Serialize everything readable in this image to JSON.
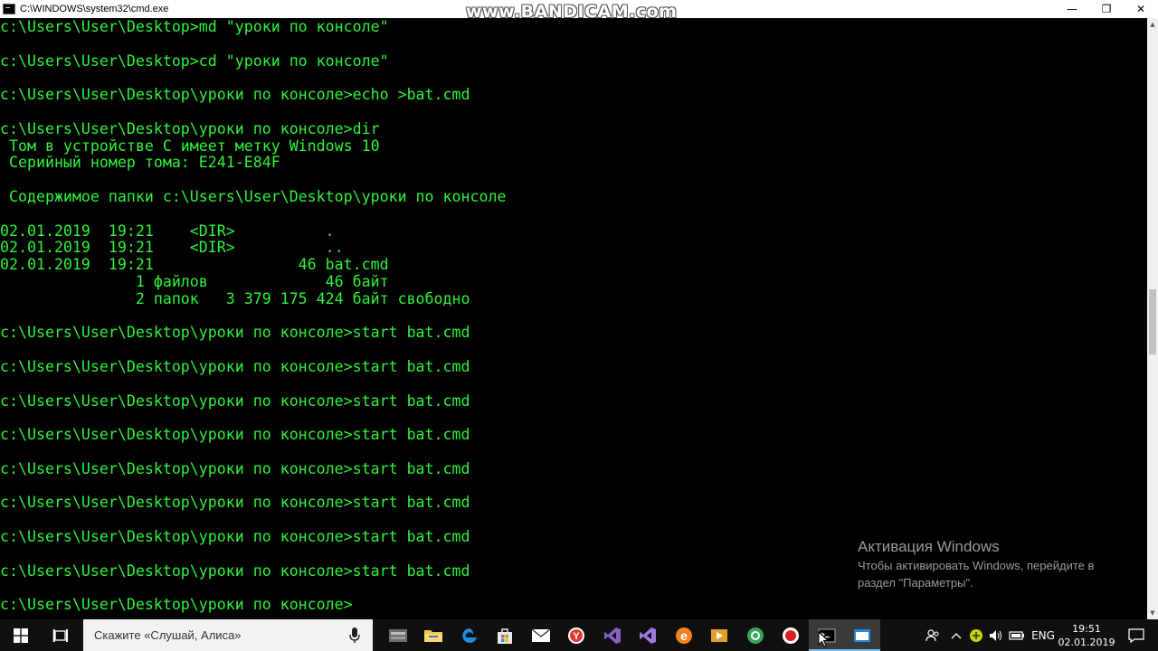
{
  "window": {
    "title": "C:\\WINDOWS\\system32\\cmd.exe",
    "watermark": "www.BANDICAM.com",
    "minimize_glyph": "—",
    "maximize_glyph": "❐",
    "close_glyph": "✕"
  },
  "console": {
    "text_color": "#2df33a",
    "lines": [
      "c:\\Users\\User\\Desktop>md \"уроки по консоле\"",
      "",
      "c:\\Users\\User\\Desktop>cd \"уроки по консоле\"",
      "",
      "c:\\Users\\User\\Desktop\\уроки по консоле>echo >bat.cmd",
      "",
      "c:\\Users\\User\\Desktop\\уроки по консоле>dir",
      " Том в устройстве C имеет метку Windows 10",
      " Серийный номер тома: E241-E84F",
      "",
      " Содержимое папки c:\\Users\\User\\Desktop\\уроки по консоле",
      "",
      "02.01.2019  19:21    <DIR>          .",
      "02.01.2019  19:21    <DIR>          ..",
      "02.01.2019  19:21                46 bat.cmd",
      "               1 файлов             46 байт",
      "               2 папок   3 379 175 424 байт свободно",
      "",
      "c:\\Users\\User\\Desktop\\уроки по консоле>start bat.cmd",
      "",
      "c:\\Users\\User\\Desktop\\уроки по консоле>start bat.cmd",
      "",
      "c:\\Users\\User\\Desktop\\уроки по консоле>start bat.cmd",
      "",
      "c:\\Users\\User\\Desktop\\уроки по консоле>start bat.cmd",
      "",
      "c:\\Users\\User\\Desktop\\уроки по консоле>start bat.cmd",
      "",
      "c:\\Users\\User\\Desktop\\уроки по консоле>start bat.cmd",
      "",
      "c:\\Users\\User\\Desktop\\уроки по консоле>start bat.cmd",
      "",
      "c:\\Users\\User\\Desktop\\уроки по консоле>start bat.cmd",
      "",
      "c:\\Users\\User\\Desktop\\уроки по консоле>"
    ]
  },
  "activation": {
    "title": "Активация Windows",
    "line1": "Чтобы активировать Windows, перейдите в",
    "line2": "раздел \"Параметры\"."
  },
  "taskbar": {
    "search_placeholder": "Скажите «Слушай, Алиса»",
    "apps": [
      {
        "name": "file-manager-icon",
        "active": false
      },
      {
        "name": "file-explorer-icon",
        "active": false
      },
      {
        "name": "edge-icon",
        "active": false
      },
      {
        "name": "store-icon",
        "active": false
      },
      {
        "name": "mail-icon",
        "active": false
      },
      {
        "name": "yandex-browser-icon",
        "active": false
      },
      {
        "name": "visual-studio-icon",
        "active": false
      },
      {
        "name": "visual-studio-2-icon",
        "active": false
      },
      {
        "name": "e-app-icon",
        "active": false
      },
      {
        "name": "media-player-icon",
        "active": false
      },
      {
        "name": "green-app-icon",
        "active": false
      },
      {
        "name": "record-icon",
        "active": false
      },
      {
        "name": "cmd-icon",
        "active": true
      },
      {
        "name": "blue-window-icon",
        "active": true
      }
    ],
    "language": "ENG",
    "time": "19:51",
    "date": "02.01.2019"
  }
}
